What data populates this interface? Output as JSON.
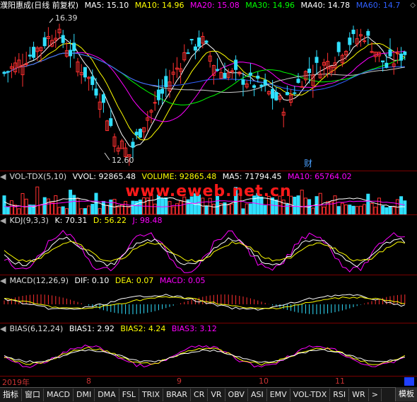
{
  "main": {
    "title": "濮阳惠成(日线 前复权)",
    "ma": [
      {
        "label": "MA5: 15.10",
        "color": "#ffffff"
      },
      {
        "label": "MA10: 14.96",
        "color": "#ffff00"
      },
      {
        "label": "MA20: 15.08",
        "color": "#ff00ff"
      },
      {
        "label": "MA30: 14.96",
        "color": "#00ff00"
      },
      {
        "label": "MA40: 14.78",
        "color": "#ffffff"
      },
      {
        "label": "MA60: 14.7",
        "color": "#3060ff"
      }
    ],
    "high_label": "16.39",
    "low_label": "12.60",
    "event_marker": "财"
  },
  "vol": {
    "title": "VOL-TDX(5,10)",
    "vvol": "VVOL: 92865.48",
    "volume": "VOLUME: 92865.48",
    "ma5": "MA5: 71794.45",
    "ma10": "MA10: 65764.02"
  },
  "kdj": {
    "title": "KDJ(9,3,3)",
    "k": "K: 70.31",
    "d": "D: 56.22",
    "j": "J: 98.48"
  },
  "macd": {
    "title": "MACD(12,26,9)",
    "dif": "DIF: 0.10",
    "dea": "DEA: 0.07",
    "macd": "MACD: 0.05"
  },
  "bias": {
    "title": "BIAS(6,12,24)",
    "b1": "BIAS1: 2.92",
    "b2": "BIAS2: 4.24",
    "b3": "BIAS3: 3.12"
  },
  "watermark": "www.eweb.net.cn",
  "dates": [
    "2019年",
    "8",
    "9",
    "10",
    "11"
  ],
  "tabs": [
    "指标",
    "窗口",
    "MACD",
    "DMI",
    "DMA",
    "FSL",
    "TRIX",
    "BRAR",
    "CR",
    "VR",
    "OBV",
    "ASI",
    "EMV",
    "VOL-TDX",
    "RSI",
    "WR"
  ],
  "tab_more": ">",
  "template_label": "模板",
  "colors": {
    "up": "#ff3030",
    "down": "#30e0ff",
    "panel_sep": "#7a0000",
    "watermark": "#ff1a1a"
  }
}
